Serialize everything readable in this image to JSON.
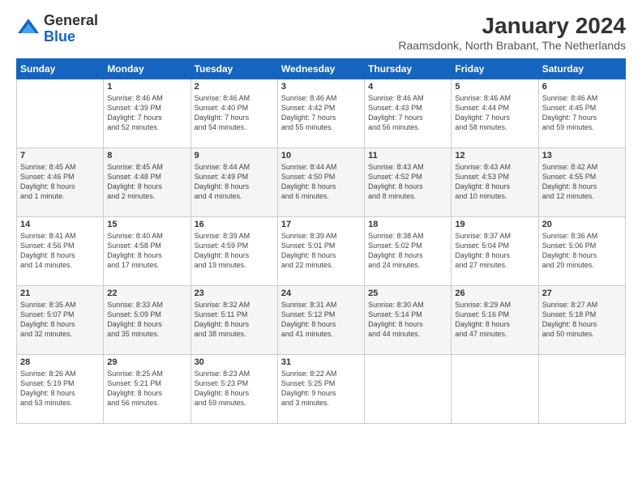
{
  "logo": {
    "general": "General",
    "blue": "Blue"
  },
  "header": {
    "month_year": "January 2024",
    "location": "Raamsdonk, North Brabant, The Netherlands"
  },
  "days_of_week": [
    "Sunday",
    "Monday",
    "Tuesday",
    "Wednesday",
    "Thursday",
    "Friday",
    "Saturday"
  ],
  "weeks": [
    [
      {
        "day": "",
        "info": ""
      },
      {
        "day": "1",
        "info": "Sunrise: 8:46 AM\nSunset: 4:39 PM\nDaylight: 7 hours\nand 52 minutes."
      },
      {
        "day": "2",
        "info": "Sunrise: 8:46 AM\nSunset: 4:40 PM\nDaylight: 7 hours\nand 54 minutes."
      },
      {
        "day": "3",
        "info": "Sunrise: 8:46 AM\nSunset: 4:42 PM\nDaylight: 7 hours\nand 55 minutes."
      },
      {
        "day": "4",
        "info": "Sunrise: 8:46 AM\nSunset: 4:43 PM\nDaylight: 7 hours\nand 56 minutes."
      },
      {
        "day": "5",
        "info": "Sunrise: 8:46 AM\nSunset: 4:44 PM\nDaylight: 7 hours\nand 58 minutes."
      },
      {
        "day": "6",
        "info": "Sunrise: 8:46 AM\nSunset: 4:45 PM\nDaylight: 7 hours\nand 59 minutes."
      }
    ],
    [
      {
        "day": "7",
        "info": "Sunrise: 8:45 AM\nSunset: 4:46 PM\nDaylight: 8 hours\nand 1 minute."
      },
      {
        "day": "8",
        "info": "Sunrise: 8:45 AM\nSunset: 4:48 PM\nDaylight: 8 hours\nand 2 minutes."
      },
      {
        "day": "9",
        "info": "Sunrise: 8:44 AM\nSunset: 4:49 PM\nDaylight: 8 hours\nand 4 minutes."
      },
      {
        "day": "10",
        "info": "Sunrise: 8:44 AM\nSunset: 4:50 PM\nDaylight: 8 hours\nand 6 minutes."
      },
      {
        "day": "11",
        "info": "Sunrise: 8:43 AM\nSunset: 4:52 PM\nDaylight: 8 hours\nand 8 minutes."
      },
      {
        "day": "12",
        "info": "Sunrise: 8:43 AM\nSunset: 4:53 PM\nDaylight: 8 hours\nand 10 minutes."
      },
      {
        "day": "13",
        "info": "Sunrise: 8:42 AM\nSunset: 4:55 PM\nDaylight: 8 hours\nand 12 minutes."
      }
    ],
    [
      {
        "day": "14",
        "info": "Sunrise: 8:41 AM\nSunset: 4:56 PM\nDaylight: 8 hours\nand 14 minutes."
      },
      {
        "day": "15",
        "info": "Sunrise: 8:40 AM\nSunset: 4:58 PM\nDaylight: 8 hours\nand 17 minutes."
      },
      {
        "day": "16",
        "info": "Sunrise: 8:39 AM\nSunset: 4:59 PM\nDaylight: 8 hours\nand 19 minutes."
      },
      {
        "day": "17",
        "info": "Sunrise: 8:39 AM\nSunset: 5:01 PM\nDaylight: 8 hours\nand 22 minutes."
      },
      {
        "day": "18",
        "info": "Sunrise: 8:38 AM\nSunset: 5:02 PM\nDaylight: 8 hours\nand 24 minutes."
      },
      {
        "day": "19",
        "info": "Sunrise: 8:37 AM\nSunset: 5:04 PM\nDaylight: 8 hours\nand 27 minutes."
      },
      {
        "day": "20",
        "info": "Sunrise: 8:36 AM\nSunset: 5:06 PM\nDaylight: 8 hours\nand 29 minutes."
      }
    ],
    [
      {
        "day": "21",
        "info": "Sunrise: 8:35 AM\nSunset: 5:07 PM\nDaylight: 8 hours\nand 32 minutes."
      },
      {
        "day": "22",
        "info": "Sunrise: 8:33 AM\nSunset: 5:09 PM\nDaylight: 8 hours\nand 35 minutes."
      },
      {
        "day": "23",
        "info": "Sunrise: 8:32 AM\nSunset: 5:11 PM\nDaylight: 8 hours\nand 38 minutes."
      },
      {
        "day": "24",
        "info": "Sunrise: 8:31 AM\nSunset: 5:12 PM\nDaylight: 8 hours\nand 41 minutes."
      },
      {
        "day": "25",
        "info": "Sunrise: 8:30 AM\nSunset: 5:14 PM\nDaylight: 8 hours\nand 44 minutes."
      },
      {
        "day": "26",
        "info": "Sunrise: 8:29 AM\nSunset: 5:16 PM\nDaylight: 8 hours\nand 47 minutes."
      },
      {
        "day": "27",
        "info": "Sunrise: 8:27 AM\nSunset: 5:18 PM\nDaylight: 8 hours\nand 50 minutes."
      }
    ],
    [
      {
        "day": "28",
        "info": "Sunrise: 8:26 AM\nSunset: 5:19 PM\nDaylight: 8 hours\nand 53 minutes."
      },
      {
        "day": "29",
        "info": "Sunrise: 8:25 AM\nSunset: 5:21 PM\nDaylight: 8 hours\nand 56 minutes."
      },
      {
        "day": "30",
        "info": "Sunrise: 8:23 AM\nSunset: 5:23 PM\nDaylight: 8 hours\nand 59 minutes."
      },
      {
        "day": "31",
        "info": "Sunrise: 8:22 AM\nSunset: 5:25 PM\nDaylight: 9 hours\nand 3 minutes."
      },
      {
        "day": "",
        "info": ""
      },
      {
        "day": "",
        "info": ""
      },
      {
        "day": "",
        "info": ""
      }
    ]
  ]
}
